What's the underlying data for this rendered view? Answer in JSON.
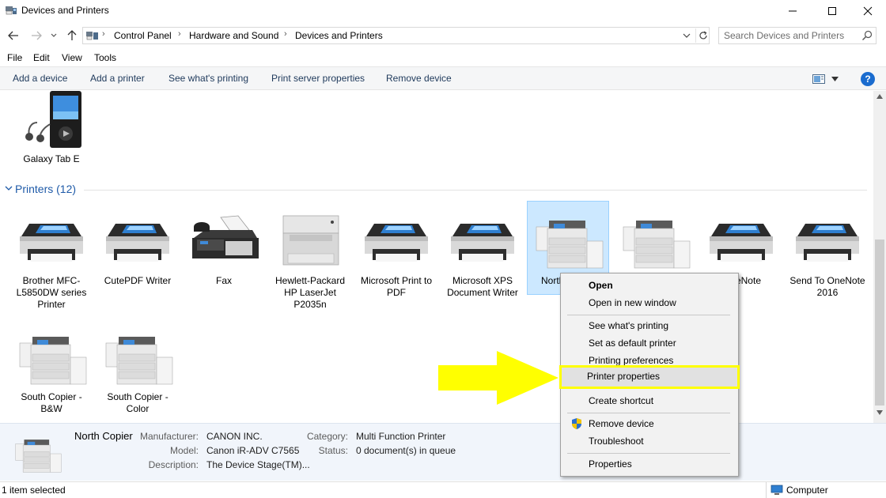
{
  "window": {
    "title": "Devices and Printers"
  },
  "address": {
    "crumbs": [
      "Control Panel",
      "Hardware and Sound",
      "Devices and Printers"
    ]
  },
  "search": {
    "placeholder": "Search Devices and Printers"
  },
  "menubar": {
    "items": [
      "File",
      "Edit",
      "View",
      "Tools"
    ]
  },
  "commandbar": {
    "items": [
      "Add a device",
      "Add a printer",
      "See what's printing",
      "Print server properties",
      "Remove device"
    ]
  },
  "devices_top": [
    {
      "label": "Galaxy Tab E",
      "icon": "media-player-icon"
    }
  ],
  "printers_group": {
    "title": "Printers (12)"
  },
  "printers": [
    {
      "label": "Brother MFC-L5850DW series Printer",
      "icon": "printer-icon"
    },
    {
      "label": "CutePDF Writer",
      "icon": "printer-icon"
    },
    {
      "label": "Fax",
      "icon": "fax-icon"
    },
    {
      "label": "Hewlett-Packard HP LaserJet P2035n",
      "icon": "laser-printer-icon"
    },
    {
      "label": "Microsoft Print to PDF",
      "icon": "printer-icon"
    },
    {
      "label": "Microsoft XPS Document Writer",
      "icon": "printer-icon"
    },
    {
      "label": "North Copier",
      "icon": "copier-icon",
      "selected": true
    },
    {
      "label": "",
      "icon": "copier-icon"
    },
    {
      "label": "OneNote",
      "icon": "printer-icon"
    },
    {
      "label": "Send To OneNote 2016",
      "icon": "printer-icon"
    },
    {
      "label": "South Copier - B&W",
      "icon": "copier-icon"
    },
    {
      "label": "South Copier - Color",
      "icon": "copier-icon"
    }
  ],
  "visible_labels": {
    "north": "North",
    "onenote_partial": "eNote"
  },
  "details": {
    "name": "North Copier",
    "manufacturer_key": "Manufacturer:",
    "manufacturer": "CANON INC.",
    "model_key": "Model:",
    "model": "Canon iR-ADV C7565",
    "description_key": "Description:",
    "description": "The Device Stage(TM)...",
    "category_key": "Category:",
    "category": "Multi Function Printer",
    "status_key": "Status:",
    "status": "0 document(s) in queue"
  },
  "statusbar": {
    "left": "1 item selected",
    "right": "Computer"
  },
  "context_menu": {
    "items": [
      {
        "label": "Open",
        "bold": true
      },
      {
        "label": "Open in new window"
      },
      {
        "label": "See what's printing"
      },
      {
        "label": "Set as default printer"
      },
      {
        "label": "Printing preferences"
      },
      {
        "label": "Printer properties",
        "highlighted": true
      },
      {
        "label": "Create shortcut"
      },
      {
        "label": "Remove device",
        "icon": "shield-icon"
      },
      {
        "label": "Troubleshoot"
      },
      {
        "label": "Properties"
      }
    ]
  },
  "colors": {
    "accent": "#1e5aa8",
    "selection": "#cce8ff",
    "highlight_outline": "#ffff00",
    "annotation_arrow": "#ffff00"
  }
}
